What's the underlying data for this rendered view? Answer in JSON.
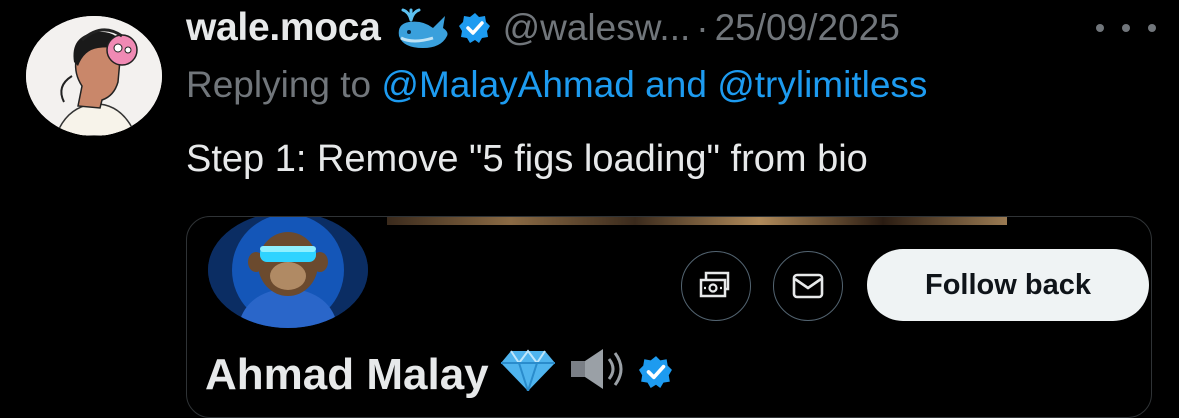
{
  "tweet": {
    "display_name": "wale.moca",
    "handle": "@walesw...",
    "separator": "·",
    "date": "25/09/2025",
    "replying_prefix": "Replying to",
    "replying_user1": "@MalayAhmad",
    "replying_and": "and",
    "replying_user2": "@trylimitless",
    "text": "Step 1: Remove \"5 figs loading\" from bio"
  },
  "card": {
    "follow_label": "Follow back",
    "profile_name": "Ahmad Malay"
  },
  "icons": {
    "more": "more-horizontal-icon",
    "verified": "verified-badge-icon",
    "whale": "whale-emoji-icon",
    "subscribe": "subscribe-icon",
    "message": "envelope-icon",
    "gem": "gem-emoji-icon",
    "speaker": "speaker-emoji-icon"
  },
  "colors": {
    "background": "#000000",
    "text": "#e7e9ea",
    "muted": "#71767b",
    "link": "#1d9bf0",
    "follow_bg": "#eff3f4"
  }
}
